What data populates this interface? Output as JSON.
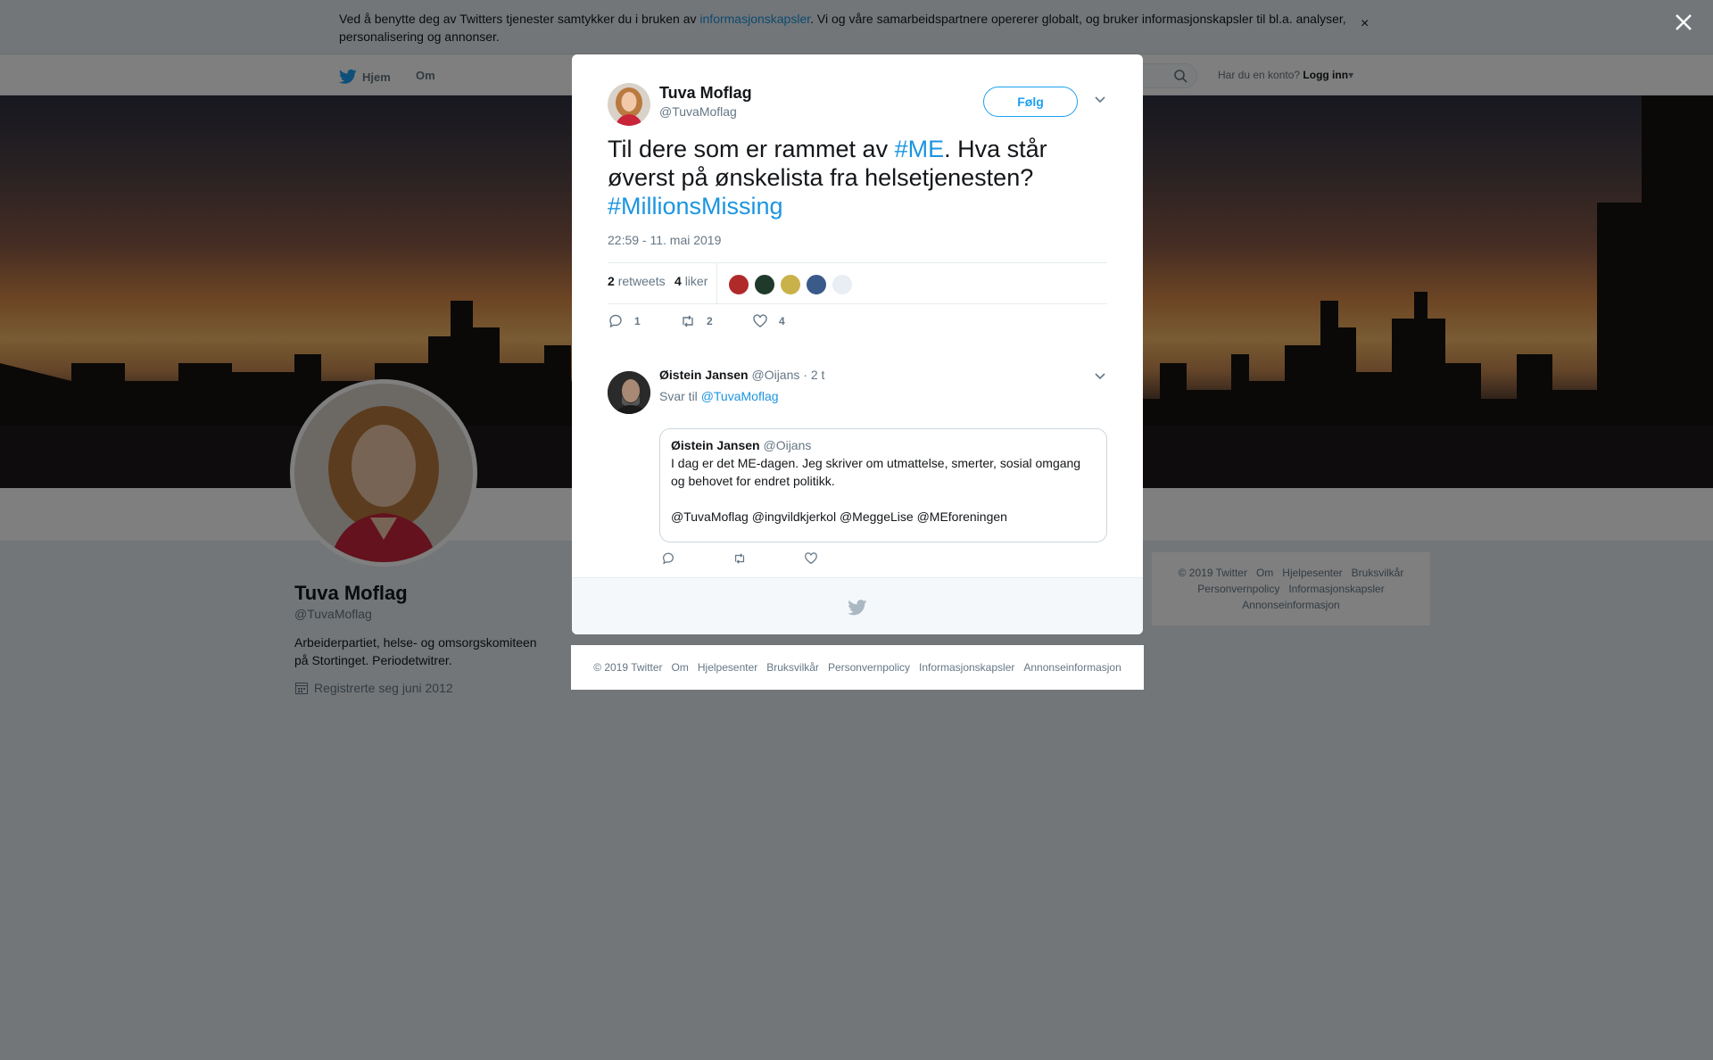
{
  "cookie_bar": {
    "text_before": "Ved å benytte deg av Twitters tjenester samtykker du i bruken av ",
    "link": "informasjonskapsler",
    "text_after": ". Vi og våre samarbeidspartnere opererer globalt, og bruker informasjonskapsler til bl.a. analyser, personalisering og annonser.",
    "close": "×"
  },
  "topnav": {
    "home": "Hjem",
    "about": "Om",
    "account_prompt": "Har du en konto?",
    "login": "Logg inn"
  },
  "profile": {
    "name": "Tuva Moflag",
    "handle": "@TuvaMoflag",
    "bio": "Arbeiderpartiet, helse- og omsorgskomiteen på Stortinget. Periodetwitrer.",
    "joined": "Registrerte seg juni 2012"
  },
  "side_footer": [
    "© 2019 Twitter",
    "Om",
    "Hjelpesenter",
    "Bruksvilkår",
    "Personvernpolicy",
    "Informasjonskapsler",
    "Annonseinformasjon"
  ],
  "tweet": {
    "name": "Tuva Moflag",
    "handle": "@TuvaMoflag",
    "follow": "Følg",
    "text_1": "Til dere som er rammet av ",
    "tag_1": "#ME",
    "text_2": ". Hva står øverst på ønskelista fra helsetjenesten? ",
    "tag_2": "#MillionsMissing",
    "timestamp": "22:59 - 11. mai 2019",
    "retweets_count": "2",
    "retweets_label": "retweets",
    "likes_count": "4",
    "likes_label": "liker",
    "reply_count": "1",
    "retweet_count": "2",
    "like_count": "4",
    "liker_colors": [
      "#b02a2a",
      "#1f3a2a",
      "#c9b24a",
      "#3a5a8a",
      "#e8eef4"
    ]
  },
  "reply": {
    "name": "Øistein Jansen",
    "handle": "@Oijans",
    "time": "· 2 t",
    "reply_to_label": "Svar til",
    "reply_to": "@TuvaMoflag",
    "quote": {
      "name": "Øistein Jansen",
      "handle": "@Oijans",
      "text": "I dag er det ME-dagen. Jeg skriver om utmattelse, smerter, sosial omgang og behovet for endret politikk.\n\n@TuvaMoflag @ingvildkjerkol @MeggeLise @MEforeningen"
    }
  },
  "modal_footer": [
    "© 2019 Twitter",
    "Om",
    "Hjelpesenter",
    "Bruksvilkår",
    "Personvernpolicy",
    "Informasjonskapsler",
    "Annonseinformasjon"
  ],
  "colors": {
    "brand": "#1da1f2",
    "link": "#1b95e0",
    "muted": "#657786"
  }
}
